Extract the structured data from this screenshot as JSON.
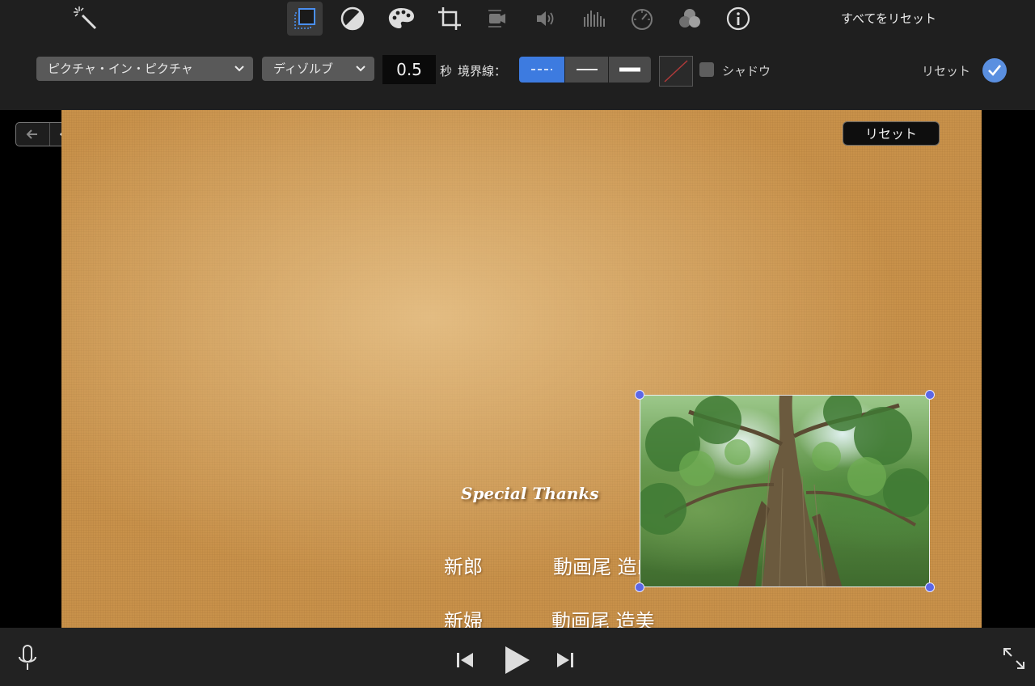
{
  "toolbar": {
    "reset_all": "すべてをリセット",
    "tools": [
      {
        "name": "magic-wand-icon"
      },
      {
        "name": "picture-in-picture-icon",
        "active": true
      },
      {
        "name": "color-balance-icon"
      },
      {
        "name": "color-palette-icon"
      },
      {
        "name": "crop-icon"
      },
      {
        "name": "stabilization-icon"
      },
      {
        "name": "volume-icon"
      },
      {
        "name": "noise-reduction-icon"
      },
      {
        "name": "speed-icon"
      },
      {
        "name": "video-filter-icon"
      },
      {
        "name": "info-icon"
      }
    ]
  },
  "controls": {
    "overlay_mode": "ピクチャ・イン・ピクチャ",
    "transition": "ディゾルブ",
    "duration": "0.5",
    "duration_unit": "秒",
    "border_label": "境界線：",
    "border_styles": [
      "dashed-line-icon",
      "thin-line-icon",
      "thick-line-icon"
    ],
    "border_selected_index": 0,
    "border_color": "none",
    "shadow_label": "シャドウ",
    "shadow_checked": false,
    "reset_label": "リセット"
  },
  "viewer": {
    "reset_button": "リセット",
    "title_text": "Special Thanks",
    "credits": [
      {
        "role": "新郎",
        "name": "動画尾 造郎"
      },
      {
        "role": "新婦",
        "name": "動画尾 造美"
      }
    ]
  },
  "colors": {
    "accent": "#3d7be0",
    "handle": "#5c67e6",
    "background_texture": "#c8914a"
  }
}
